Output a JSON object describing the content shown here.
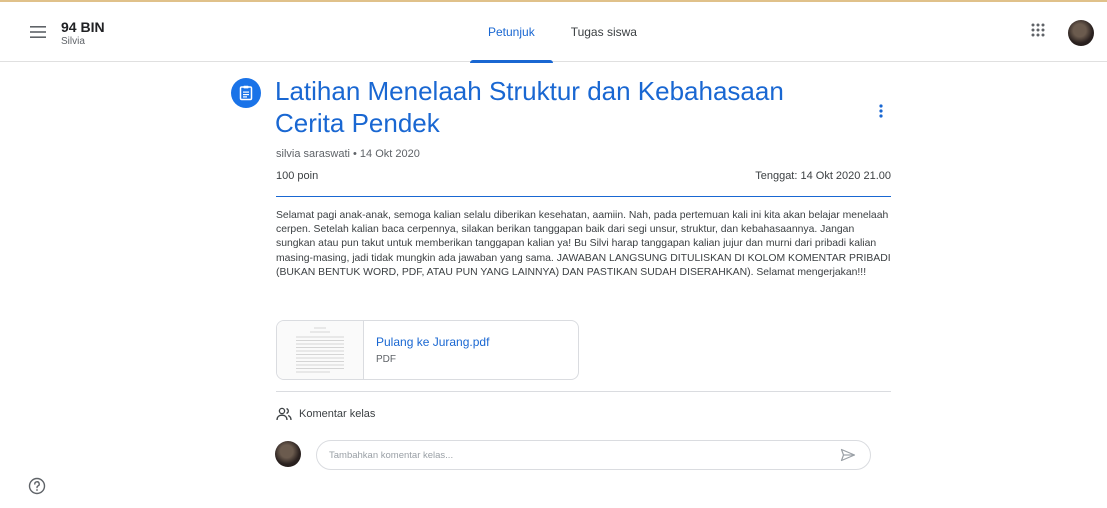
{
  "header": {
    "class_name": "94 BIN",
    "class_sub": "Silvia",
    "tabs": [
      {
        "label": "Petunjuk",
        "active": true
      },
      {
        "label": "Tugas siswa",
        "active": false
      }
    ]
  },
  "assignment": {
    "title": "Latihan Menelaah Struktur dan Kebahasaan Cerita Pendek",
    "meta": "silvia saraswati • 14 Okt 2020",
    "points": "100 poin",
    "due": "Tenggat: 14 Okt 2020 21.00",
    "description": "Selamat pagi anak-anak, semoga kalian selalu diberikan kesehatan, aamiin. Nah, pada pertemuan kali ini kita akan belajar menelaah cerpen. Setelah kalian baca cerpennya, silakan berikan tanggapan baik dari segi unsur, struktur, dan kebahasaannya. Jangan sungkan atau pun takut untuk memberikan tanggapan kalian ya! Bu Silvi harap tanggapan kalian jujur dan murni dari pribadi kalian masing-masing, jadi tidak mungkin ada jawaban yang sama. JAWABAN LANGSUNG DITULISKAN DI KOLOM KOMENTAR PRIBADI (BUKAN BENTUK WORD, PDF, ATAU PUN YANG LAINNYA) DAN PASTIKAN SUDAH DISERAHKAN). Selamat mengerjakan!!!",
    "attachment": {
      "name": "Pulang ke Jurang.pdf",
      "type": "PDF"
    }
  },
  "comments": {
    "heading": "Komentar kelas",
    "placeholder": "Tambahkan komentar kelas..."
  },
  "icons": {
    "menu": "hamburger-icon",
    "apps": "apps-grid-icon",
    "assignment": "assignment-icon",
    "more": "more-vert-icon",
    "people": "people-icon",
    "send": "send-icon",
    "help": "help-icon"
  },
  "colors": {
    "accent": "#1967d2",
    "icon_bg": "#1a73e8",
    "top_accent": "#e0c18a"
  }
}
